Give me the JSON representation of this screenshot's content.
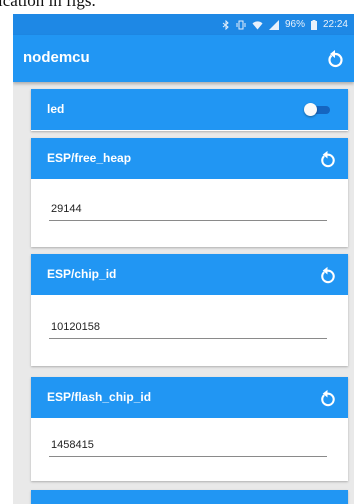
{
  "caption": "ication in figs.",
  "statusbar": {
    "icons": [
      "bluetooth-icon",
      "vibrate-icon",
      "wifi-icon",
      "signal-icon",
      "battery-icon"
    ],
    "battery": "96%",
    "time": "22:24"
  },
  "appbar": {
    "title": "nodemcu",
    "refresh_icon": "refresh-icon"
  },
  "led": {
    "label": "led",
    "toggle": "off"
  },
  "topics": [
    {
      "label": "ESP/free_heap",
      "value": "29144"
    },
    {
      "label": "ESP/chip_id",
      "value": "10120158"
    },
    {
      "label": "ESP/flash_chip_id",
      "value": "1458415"
    }
  ],
  "colors": {
    "status_bar": "#1e88e5",
    "app_bar": "#2196f3",
    "card_header": "#2196f3",
    "background": "#e9e9e9"
  }
}
